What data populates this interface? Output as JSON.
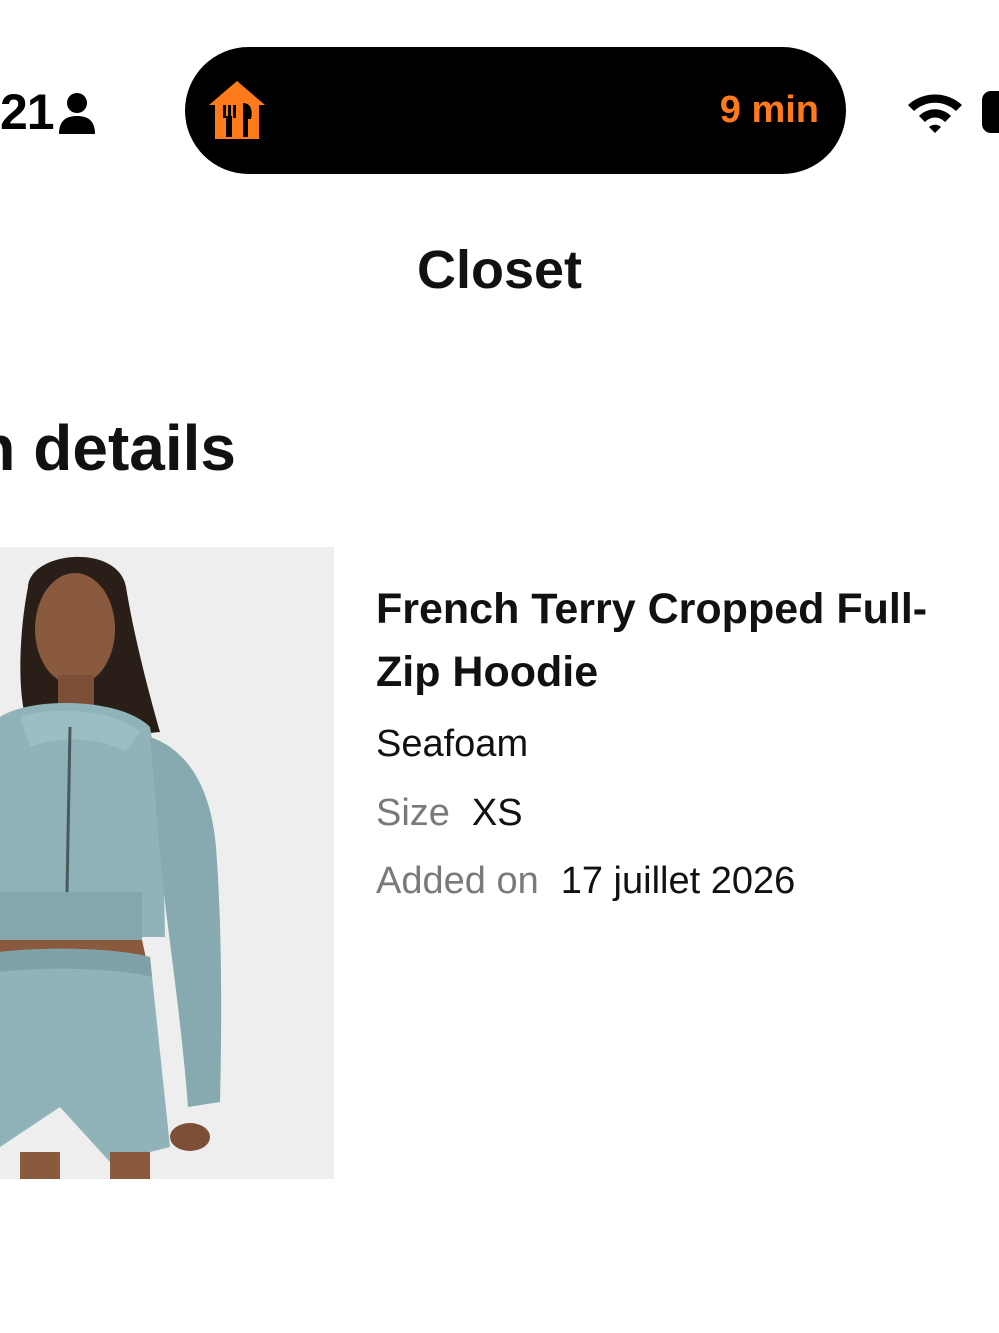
{
  "status_bar": {
    "time": "21",
    "person_icon": "person-icon",
    "wifi_icon": "wifi-icon",
    "battery_icon": "battery-icon"
  },
  "live_activity": {
    "app_icon": "restaurant-home-icon",
    "eta": "9 min",
    "accent_color": "#ff7a1a"
  },
  "header": {
    "title": "Closet"
  },
  "section": {
    "heading": "n details"
  },
  "item": {
    "name": "French Terry Cropped Full-Zip Hoodie",
    "color": "Seafoam",
    "size_label": "Size",
    "size_value": "XS",
    "added_label": "Added on",
    "added_value": "17 juillet 2026",
    "image_background": "#eeeeef",
    "garment_color": "#8fb3b9"
  }
}
